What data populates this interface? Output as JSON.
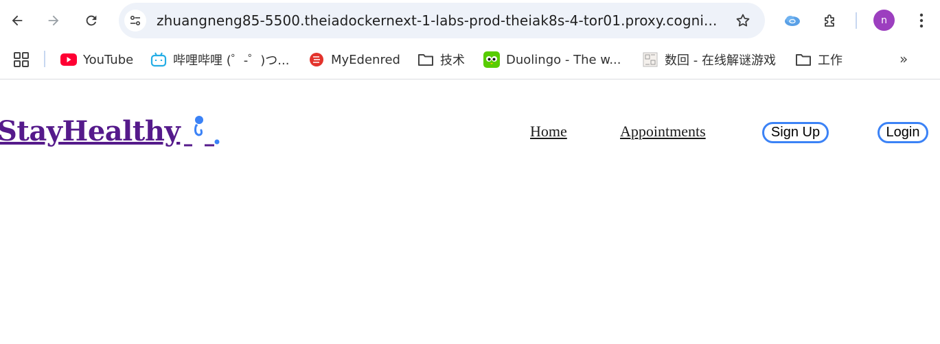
{
  "browser": {
    "url": "zhuangneng85-5500.theiadockernext-1-labs-prod-theiak8s-4-tor01.proxy.cogni...",
    "avatar_initial": "n",
    "icons": [
      "back-icon",
      "forward-icon",
      "reload-icon",
      "site-info-icon",
      "star-icon",
      "extension-cloud-icon",
      "puzzle-icon",
      "menu-icon"
    ]
  },
  "bookmarks": {
    "items": [
      {
        "label": "YouTube",
        "icon": "youtube-icon"
      },
      {
        "label": "哔哩哔哩 (゜-゜)つ...",
        "icon": "bilibili-icon"
      },
      {
        "label": "MyEdenred",
        "icon": "edenred-icon"
      },
      {
        "label": "技术",
        "icon": "folder-icon"
      },
      {
        "label": "Duolingo - The w...",
        "icon": "duolingo-icon"
      },
      {
        "label": "数回 - 在线解谜游戏",
        "icon": "puzzle-grid-icon"
      },
      {
        "label": "工作",
        "icon": "folder-icon"
      }
    ],
    "more_label": "»"
  },
  "site": {
    "logo_text": "StayHealthy",
    "nav": {
      "home": "Home",
      "appointments": "Appointments",
      "sign_up": "Sign Up",
      "login": "Login"
    }
  },
  "colors": {
    "logo": "#551a8b",
    "accent_blue": "#3b82f6",
    "omnibox_bg": "#eef2f9",
    "avatar_bg": "#9c3fbf"
  }
}
